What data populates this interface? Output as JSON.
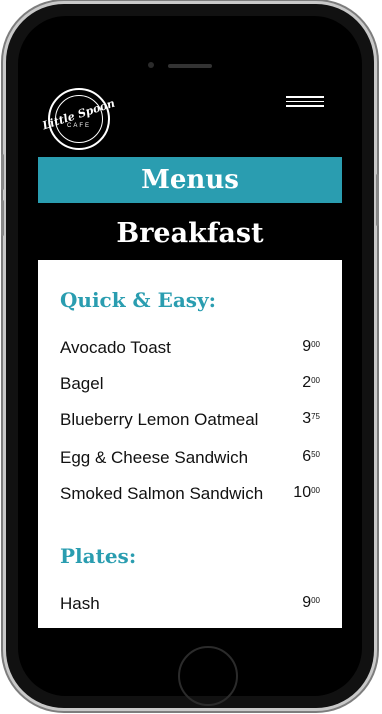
{
  "logo": {
    "name": "Little Spoon",
    "sub": "CAFE"
  },
  "banner": {
    "title": "Menus"
  },
  "section": {
    "title": "Breakfast"
  },
  "groups": [
    {
      "heading": "Quick & Easy:",
      "items": [
        {
          "name": "Avocado Toast",
          "price_main": "9",
          "price_cents": "00"
        },
        {
          "name": "Bagel",
          "price_main": "2",
          "price_cents": "00"
        },
        {
          "name": "Blueberry Lemon Oatmeal",
          "price_main": "3",
          "price_cents": "75"
        },
        {
          "name": "Egg & Cheese Sandwich",
          "price_main": "6",
          "price_cents": "50"
        },
        {
          "name": "Smoked Salmon Sandwich",
          "price_main": "10",
          "price_cents": "00"
        }
      ]
    },
    {
      "heading": "Plates:",
      "items": [
        {
          "name": "Hash",
          "price_main": "9",
          "price_cents": "00"
        }
      ]
    }
  ],
  "colors": {
    "accent": "#2a9db0",
    "background": "#000000",
    "card": "#ffffff"
  }
}
